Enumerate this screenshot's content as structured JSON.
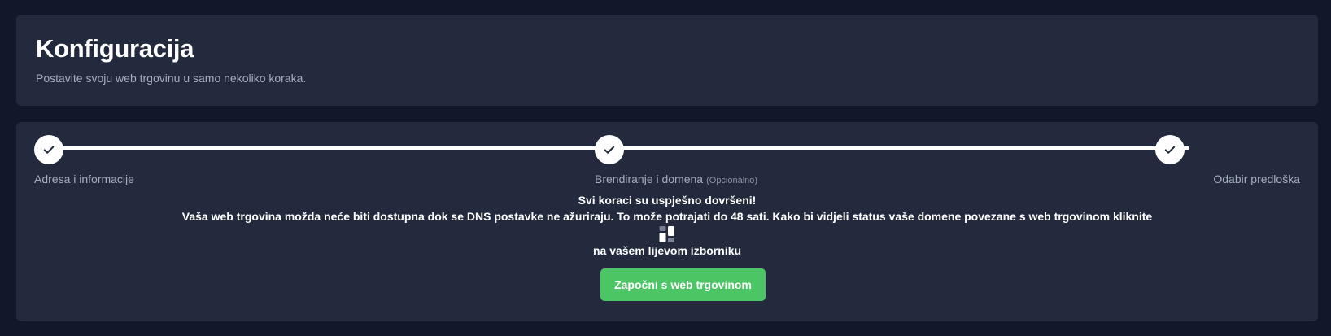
{
  "header": {
    "title": "Konfiguracija",
    "subtitle": "Postavite svoju web trgovinu u samo nekoliko koraka."
  },
  "steps": [
    {
      "label": "Adresa i informacije",
      "optional": "",
      "status": "completed"
    },
    {
      "label": "Brendiranje i domena",
      "optional": "(Opcionalno)",
      "status": "completed"
    },
    {
      "label": "Odabir predloška",
      "optional": "",
      "status": "completed"
    }
  ],
  "message": {
    "success": "Svi koraci su uspješno dovršeni!",
    "dns_notice": "Vaša web trgovina možda neće biti dostupna dok se DNS postavke ne ažuriraju. To može potrajati do 48 sati. Kako bi vidjeli status vaše domene povezane s web trgovinom kliknite",
    "menu_hint": "na vašem lijevom izborniku",
    "menu_icon": "dashboard-icon"
  },
  "actions": {
    "start_label": "Započni s web trgovinom"
  },
  "colors": {
    "background": "#121729",
    "card": "#232a3d",
    "accent": "#4cc665",
    "muted_text": "#a6adbf"
  }
}
